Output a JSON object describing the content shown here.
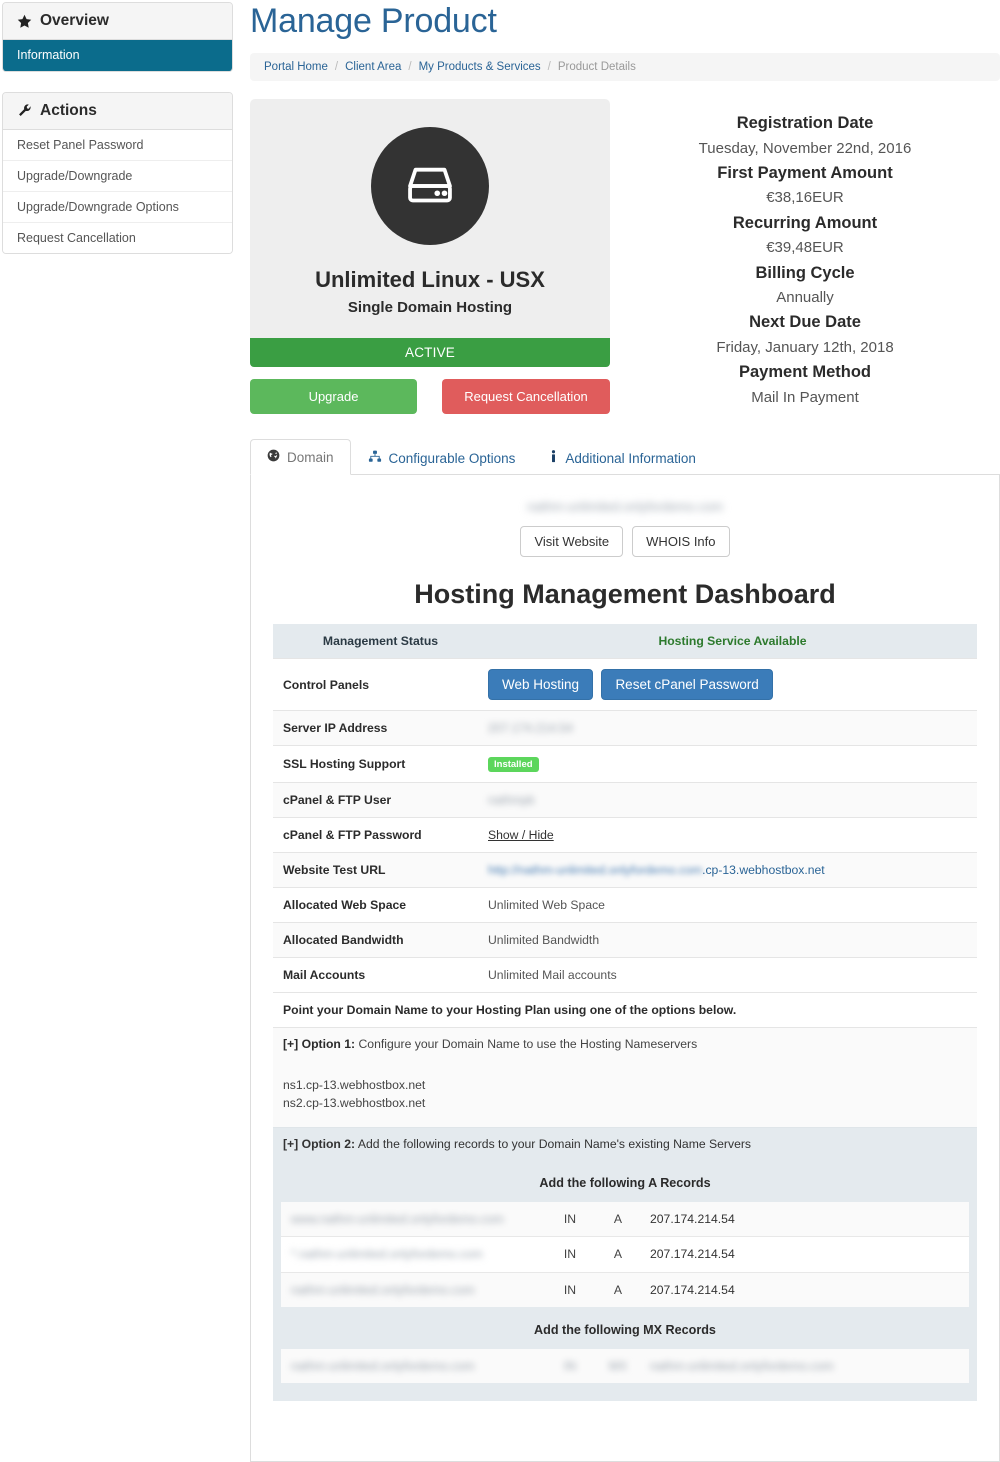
{
  "sidebar": {
    "overview": {
      "title": "Overview",
      "icon": "star-icon",
      "items": [
        {
          "label": "Information",
          "active": true
        }
      ]
    },
    "actions": {
      "title": "Actions",
      "icon": "wrench-icon",
      "items": [
        {
          "label": "Reset Panel Password"
        },
        {
          "label": "Upgrade/Downgrade"
        },
        {
          "label": "Upgrade/Downgrade Options"
        },
        {
          "label": "Request Cancellation"
        }
      ]
    }
  },
  "header": {
    "title": "Manage Product",
    "breadcrumb": [
      {
        "label": "Portal Home",
        "link": true
      },
      {
        "label": "Client Area",
        "link": true
      },
      {
        "label": "My Products & Services",
        "link": true
      },
      {
        "label": "Product Details",
        "link": false
      }
    ],
    "separator": "/"
  },
  "product": {
    "icon": "hard-drive-icon",
    "name": "Unlimited Linux - USX",
    "subtitle": "Single Domain Hosting",
    "status": "ACTIVE",
    "status_color": "#3a9e43",
    "buttons": {
      "upgrade": "Upgrade",
      "cancel": "Request Cancellation",
      "upgrade_color": "#5cb85c",
      "cancel_color": "#e05c5c"
    }
  },
  "billing": [
    {
      "label": "Registration Date",
      "value": "Tuesday, November 22nd, 2016"
    },
    {
      "label": "First Payment Amount",
      "value": "€38,16EUR"
    },
    {
      "label": "Recurring Amount",
      "value": "€39,48EUR"
    },
    {
      "label": "Billing Cycle",
      "value": "Annually"
    },
    {
      "label": "Next Due Date",
      "value": "Friday, January 12th, 2018"
    },
    {
      "label": "Payment Method",
      "value": "Mail In Payment"
    }
  ],
  "tabs": [
    {
      "label": "Domain",
      "icon": "globe-icon",
      "active": true
    },
    {
      "label": "Configurable Options",
      "icon": "sitemap-icon",
      "active": false
    },
    {
      "label": "Additional Information",
      "icon": "info-icon",
      "active": false
    }
  ],
  "domain_panel": {
    "domain_name_redacted": "nathm-unlimited.onlyfordemo.com",
    "visit_website": "Visit Website",
    "whois_info": "WHOIS Info",
    "dashboard_title": "Hosting Management Dashboard",
    "table_header": {
      "left": "Management Status",
      "right": "Hosting Service Available",
      "right_color": "#2d7a2d"
    },
    "rows": [
      {
        "key": "Control Panels",
        "type": "buttons",
        "buttons": [
          "Web Hosting",
          "Reset cPanel Password"
        ],
        "button_color": "#3b7cb9"
      },
      {
        "key": "Server IP Address",
        "type": "redacted",
        "value": "207.174.214.54"
      },
      {
        "key": "SSL Hosting Support",
        "type": "badge",
        "value": "Installed",
        "badge_color": "#5cd65c"
      },
      {
        "key": "cPanel & FTP User",
        "type": "redacted",
        "value": "nathmpk"
      },
      {
        "key": "cPanel & FTP Password",
        "type": "link",
        "value": "Show / Hide"
      },
      {
        "key": "Website Test URL",
        "type": "url",
        "redacted_prefix": "http://nathm-unlimited.onlyfordemo.com",
        "visible_suffix": ".cp-13.webhostbox.net"
      },
      {
        "key": "Allocated Web Space",
        "type": "text",
        "value": "Unlimited Web Space"
      },
      {
        "key": "Allocated Bandwidth",
        "type": "text",
        "value": "Unlimited Bandwidth"
      },
      {
        "key": "Mail Accounts",
        "type": "text",
        "value": "Unlimited Mail accounts"
      }
    ],
    "point_note": "Point your Domain Name to your Hosting Plan using one of the options below.",
    "option1": {
      "prefix": "[+] Option 1:",
      "text": "Configure your Domain Name to use the Hosting Nameservers",
      "nameservers": [
        "ns1.cp-13.webhostbox.net",
        "ns2.cp-13.webhostbox.net"
      ]
    },
    "option2": {
      "prefix": "[+] Option 2:",
      "text": "Add the following records to your Domain Name's existing Name Servers",
      "a_records_title": "Add the following A Records",
      "a_records": [
        {
          "name": "www.nathm-unlimited.onlyfordemo.com",
          "class": "IN",
          "type": "A",
          "value": "207.174.214.54"
        },
        {
          "name": "*.nathm-unlimited.onlyfordemo.com",
          "class": "IN",
          "type": "A",
          "value": "207.174.214.54"
        },
        {
          "name": "nathm-unlimited.onlyfordemo.com",
          "class": "IN",
          "type": "A",
          "value": "207.174.214.54"
        }
      ],
      "mx_records_title": "Add the following MX Records",
      "mx_records": [
        {
          "name": "nathm-unlimited.onlyfordemo.com",
          "class": "IN",
          "type": "MX",
          "value": "nathm-unlimited.onlyfordemo.com"
        }
      ]
    }
  }
}
